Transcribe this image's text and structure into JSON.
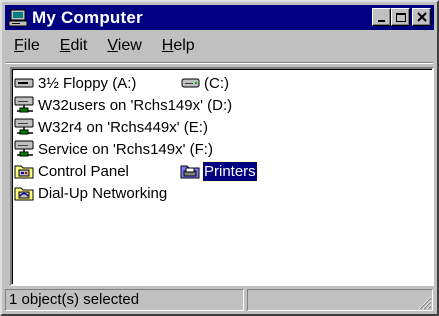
{
  "window": {
    "title": "My Computer",
    "title_icon": "computer-icon"
  },
  "menu": {
    "items": [
      {
        "label": "File",
        "mnemonic": "F"
      },
      {
        "label": "Edit",
        "mnemonic": "E"
      },
      {
        "label": "View",
        "mnemonic": "V"
      },
      {
        "label": "Help",
        "mnemonic": "H"
      }
    ]
  },
  "content": {
    "items": [
      {
        "label": "3½ Floppy (A:)",
        "icon": "floppy-drive-icon"
      },
      {
        "label": "(C:)",
        "icon": "hard-drive-icon"
      },
      {
        "label": "W32users on 'Rchs149x' (D:)",
        "icon": "network-drive-icon"
      },
      {
        "label": "W32r4 on 'Rchs449x' (E:)",
        "icon": "network-drive-icon"
      },
      {
        "label": "Service on 'Rchs149x' (F:)",
        "icon": "network-drive-icon"
      },
      {
        "label": "Control Panel",
        "icon": "control-panel-folder-icon"
      },
      {
        "label": "Printers",
        "icon": "printers-folder-icon",
        "selected": true
      },
      {
        "label": "Dial-Up Networking",
        "icon": "dialup-folder-icon"
      }
    ]
  },
  "status": {
    "text": "1 object(s) selected",
    "pane2": ""
  }
}
